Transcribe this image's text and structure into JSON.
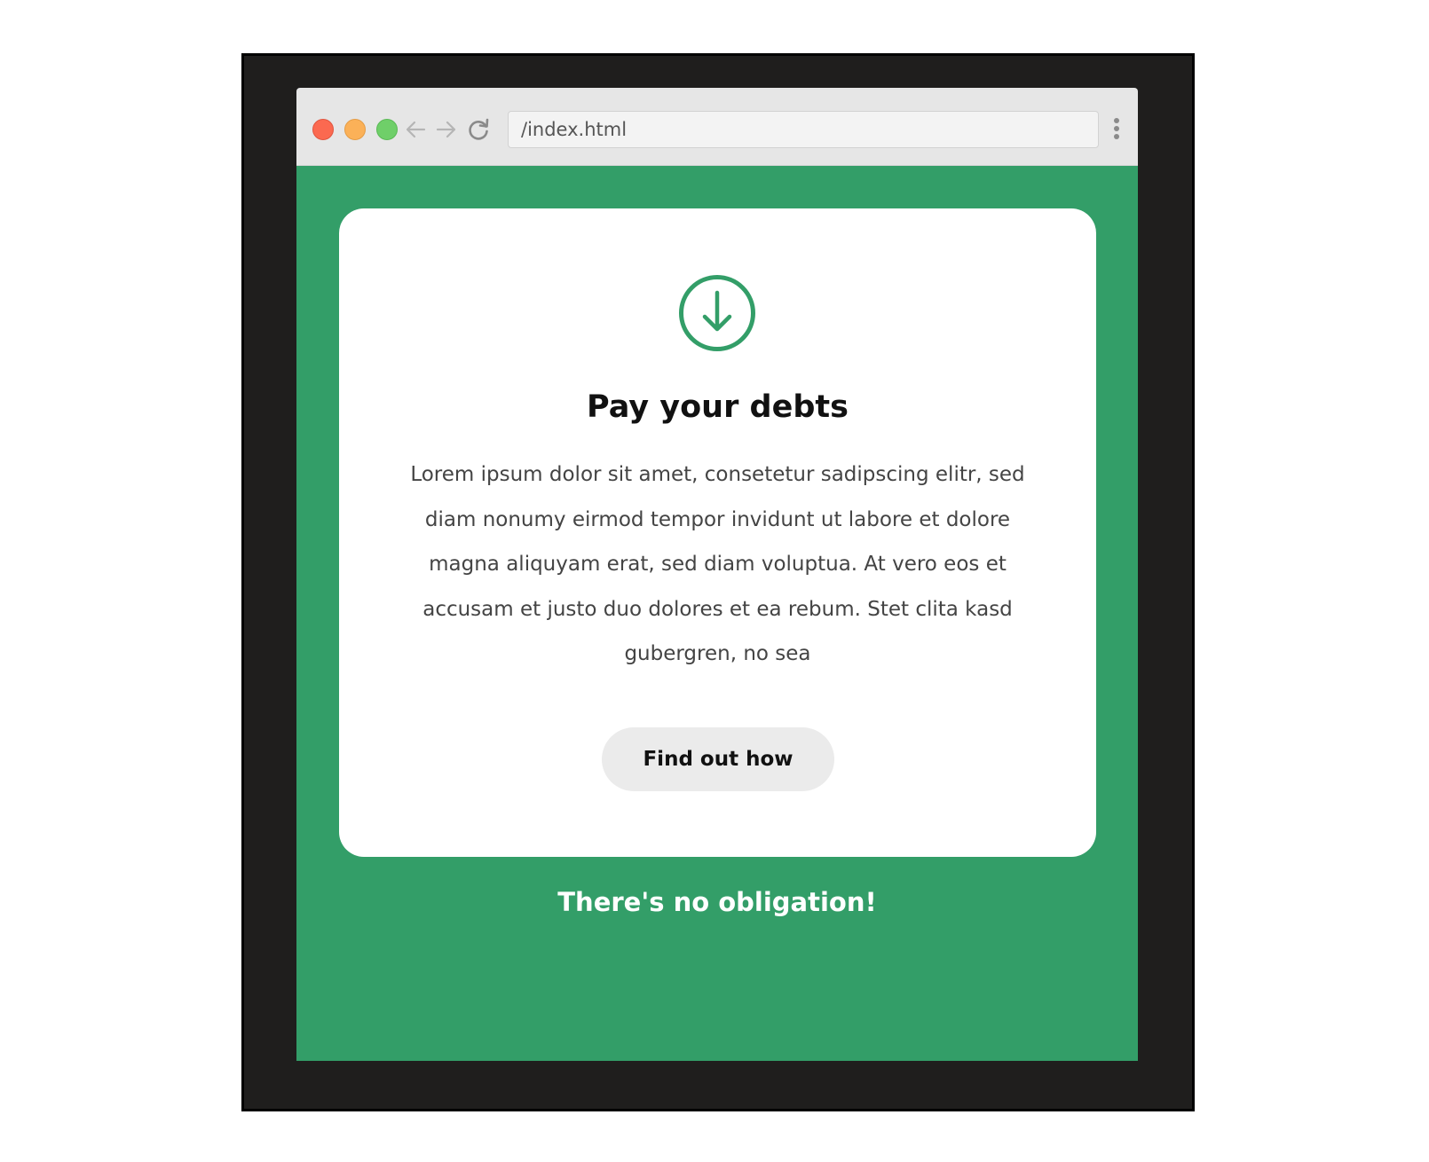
{
  "browser": {
    "url": "/index.html",
    "controls": {
      "close": "close-window-icon",
      "minimize": "minimize-window-icon",
      "maximize": "maximize-window-icon",
      "back": "back-arrow-icon",
      "forward": "forward-arrow-icon",
      "reload": "reload-icon",
      "menu": "more-vertical-icon"
    }
  },
  "card": {
    "icon": "arrow-down-circle-icon",
    "title": "Pay your debts",
    "body": "Lorem ipsum dolor sit amet, consetetur sadipscing elitr, sed diam nonumy eirmod tempor invidunt ut labore et dolore magna aliquyam erat, sed diam voluptua. At vero eos et accusam et justo duo dolores et ea rebum. Stet clita kasd gubergren, no sea",
    "button_label": "Find out how"
  },
  "tagline": "There's no obligation!",
  "colors": {
    "background": "#339e68",
    "accent": "#339e68",
    "card": "#ffffff",
    "button": "#ebebeb",
    "frame": "#1f1e1d"
  }
}
